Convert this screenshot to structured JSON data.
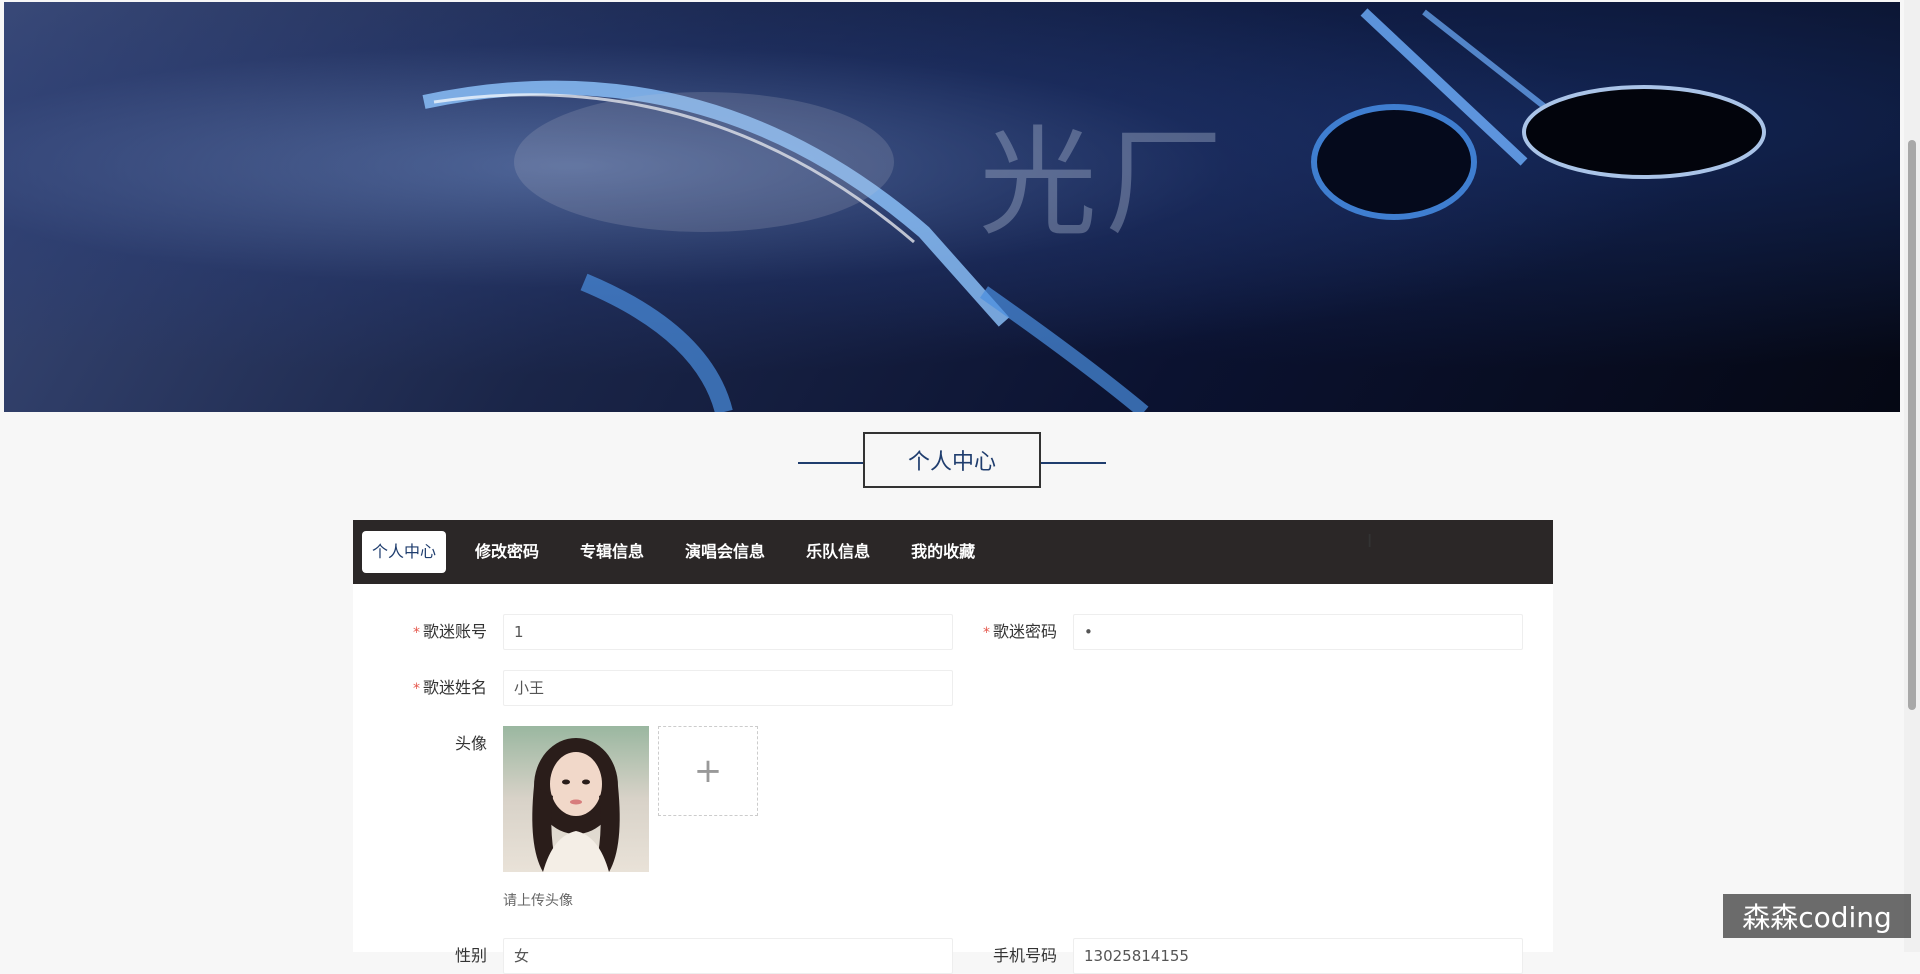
{
  "banner": {
    "logo_text": "光厂"
  },
  "page_title": "个人中心",
  "nav": {
    "items": [
      "个人中心",
      "修改密码",
      "专辑信息",
      "演唱会信息",
      "乐队信息",
      "我的收藏"
    ],
    "active_index": 0
  },
  "form": {
    "account": {
      "label": "歌迷账号",
      "value": "1",
      "required": true
    },
    "password": {
      "label": "歌迷密码",
      "value": "•",
      "required": true
    },
    "name": {
      "label": "歌迷姓名",
      "value": "小王",
      "required": true
    },
    "avatar": {
      "label": "头像",
      "hint": "请上传头像",
      "upload_icon": "plus-icon"
    },
    "gender": {
      "label": "性别",
      "value": "女"
    },
    "phone": {
      "label": "手机号码",
      "value": "13025814155"
    }
  },
  "watermark": "森森coding",
  "colors": {
    "nav_bg": "#2b2727",
    "accent": "#1f3d6e",
    "required": "#e5574c"
  }
}
